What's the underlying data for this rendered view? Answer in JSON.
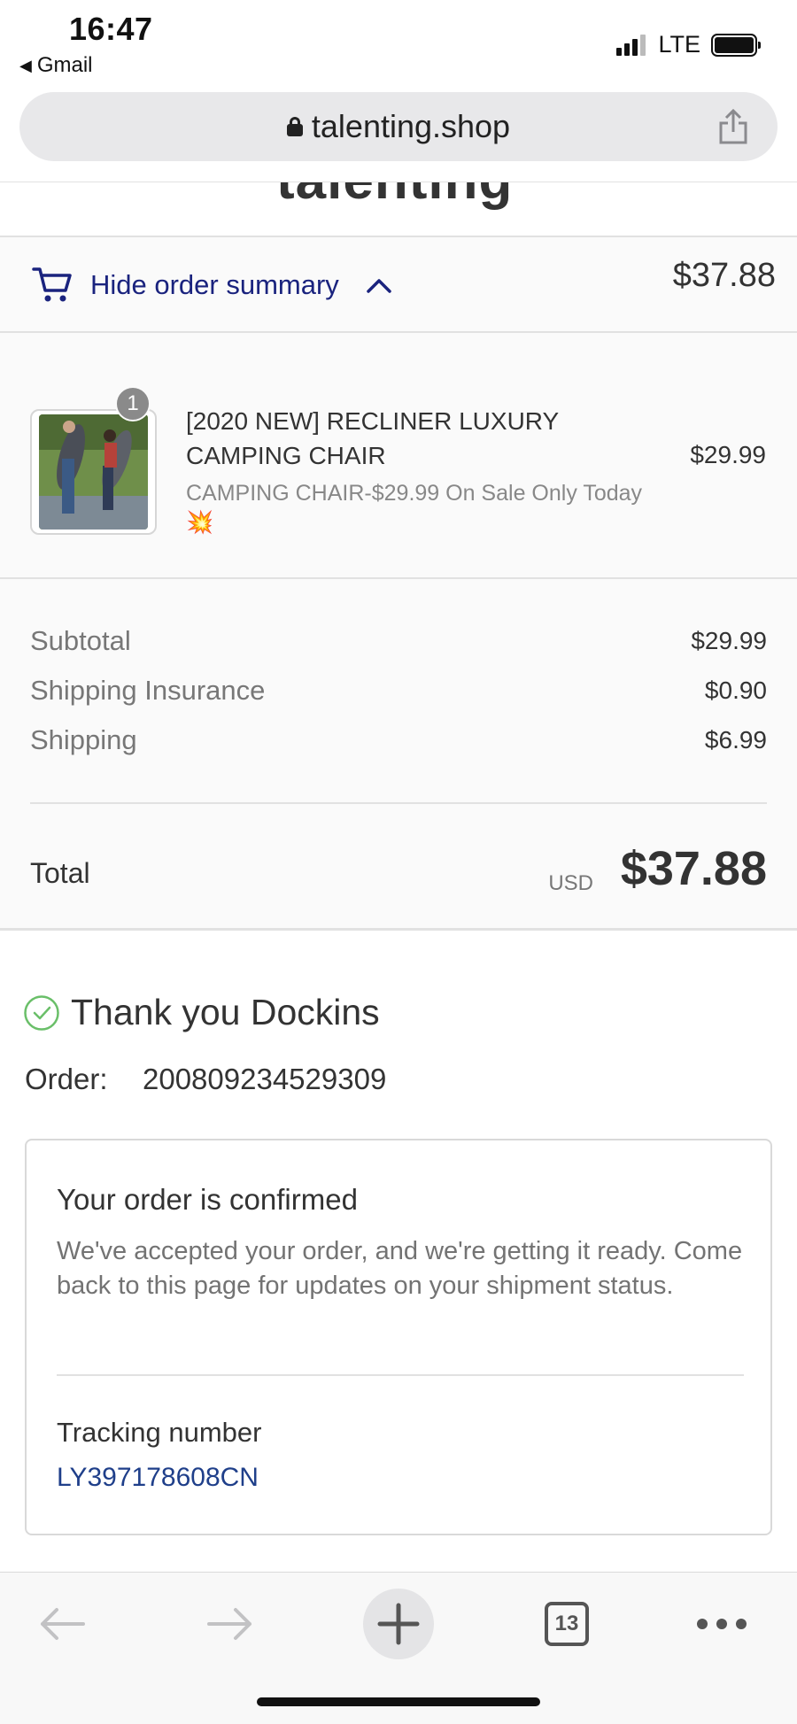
{
  "status_bar": {
    "time": "16:47",
    "back_app": "Gmail",
    "network": "LTE"
  },
  "browser": {
    "url": "talenting.shop",
    "tab_count": "13"
  },
  "store": {
    "logo": "talenting"
  },
  "summary_toggle": {
    "label": "Hide order summary",
    "total": "$37.88"
  },
  "product": {
    "quantity": "1",
    "title": "[2020 NEW] RECLINER LUXURY CAMPING CHAIR",
    "variant": "CAMPING CHAIR-$29.99 On Sale Only Today 💥",
    "price": "$29.99"
  },
  "cost_lines": [
    {
      "label": "Subtotal",
      "value": "$29.99"
    },
    {
      "label": "Shipping Insurance",
      "value": "$0.90"
    },
    {
      "label": "Shipping",
      "value": "$6.99"
    }
  ],
  "total": {
    "label": "Total",
    "currency": "USD",
    "value": "$37.88"
  },
  "thank_you": {
    "message": "Thank you Dockins",
    "order_label": "Order:",
    "order_number": "200809234529309"
  },
  "confirmation": {
    "title": "Your order is confirmed",
    "body": "We've accepted your order, and we're getting it ready. Come back to this page for updates on your shipment status.",
    "tracking_label": "Tracking number",
    "tracking_number": "LY397178608CN"
  },
  "colors": {
    "link_blue": "#1a237e",
    "tracking_blue": "#1f3f8a",
    "check_green": "#6abf69"
  },
  "icons": [
    "lock-icon",
    "share-icon",
    "cart-icon",
    "chevron-up-icon",
    "check-circle-icon",
    "back-arrow-icon",
    "forward-arrow-icon",
    "plus-icon",
    "tabs-icon",
    "more-icon"
  ]
}
